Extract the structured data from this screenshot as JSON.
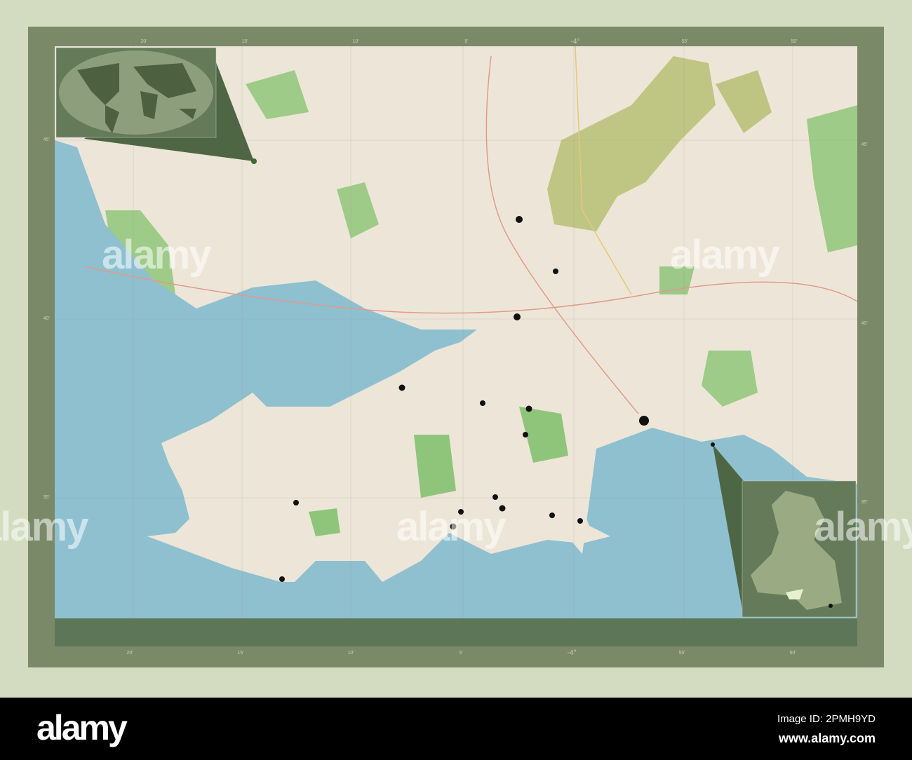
{
  "map": {
    "colors": {
      "background": "#d3dcc0",
      "frame": "#7a8a68",
      "land": "#ede6d8",
      "sea": "#8ec0d0",
      "green": "#8fc57a",
      "olive": "#b9c27a",
      "inset": "#5c7250"
    },
    "top_ticks": [
      "20'",
      "15'",
      "10'",
      "5'",
      "-4°",
      "55'",
      "50'"
    ],
    "bottom_ticks": [
      "20'",
      "15'",
      "10'",
      "5'",
      "-4°",
      "55'",
      "50'"
    ],
    "left_ticks": [
      "45'",
      "40'",
      "35'"
    ],
    "right_ticks": [
      "45'",
      "40'",
      "35'"
    ]
  },
  "watermark": "alamy",
  "footer": {
    "logo": "alamy",
    "image_id": "Image ID: 2PMH9YD",
    "url": "www.alamy.com"
  }
}
